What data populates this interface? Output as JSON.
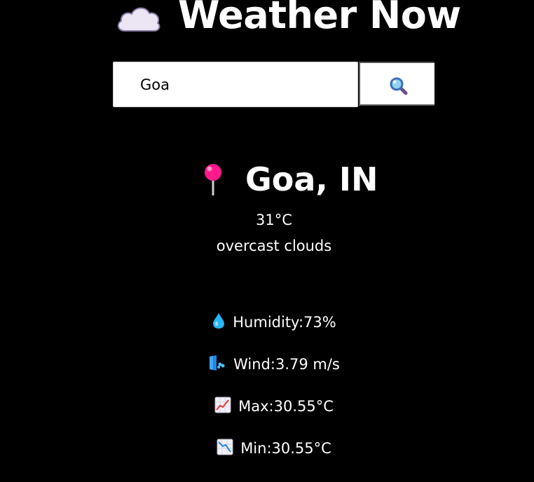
{
  "header": {
    "title": "Weather Now",
    "icon": "cloud-icon"
  },
  "search": {
    "value": "Goa",
    "button_icon": "magnifier-icon"
  },
  "weather": {
    "location": "Goa, IN",
    "location_icon": "pin-icon",
    "temperature": "31°C",
    "description": "overcast clouds"
  },
  "details": [
    {
      "icon": "droplet-icon",
      "text": "Humidity:73%"
    },
    {
      "icon": "wind-icon",
      "text": "Wind:3.79 m/s"
    },
    {
      "icon": "chart-increasing-icon",
      "text": "Max:30.55°C"
    },
    {
      "icon": "chart-decreasing-icon",
      "text": "Min:30.55°C"
    }
  ],
  "colors": {
    "background": "#000000",
    "text": "#ffffff",
    "pin": "#ff1a8c",
    "droplet": "#29b6f6"
  }
}
